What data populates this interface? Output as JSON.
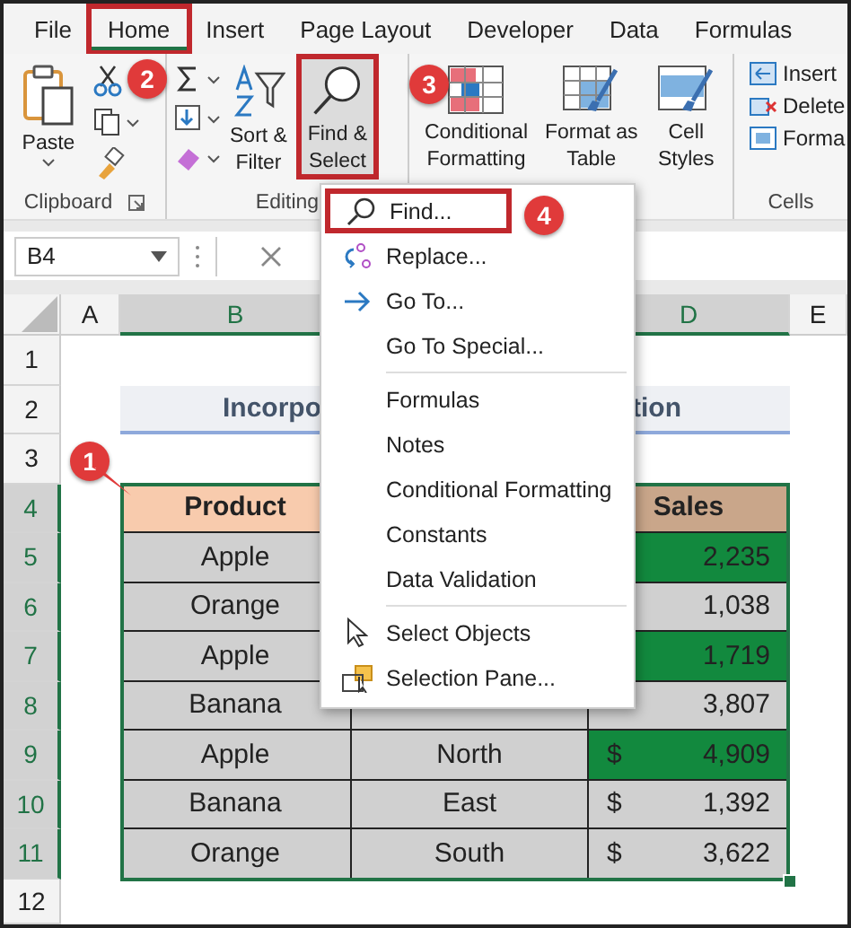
{
  "tabs": [
    {
      "label": "File",
      "selected": false,
      "boxed": false
    },
    {
      "label": "Home",
      "selected": true,
      "boxed": true
    },
    {
      "label": "Insert",
      "selected": false,
      "boxed": false
    },
    {
      "label": "Page Layout",
      "selected": false,
      "boxed": false
    },
    {
      "label": "Developer",
      "selected": false,
      "boxed": false
    },
    {
      "label": "Data",
      "selected": false,
      "boxed": false
    },
    {
      "label": "Formulas",
      "selected": false,
      "boxed": false
    }
  ],
  "clipboard": {
    "label": "Clipboard",
    "paste": "Paste"
  },
  "editing": {
    "label": "Editing",
    "sort_filter": [
      "Sort &",
      "Filter"
    ],
    "find_select": {
      "lines": [
        "Find &",
        "Select"
      ],
      "boxed": true
    }
  },
  "styles": {
    "conditional": [
      "Conditional",
      "Formatting"
    ],
    "format_table": [
      "Format as",
      "Table"
    ],
    "cell_styles": [
      "Cell",
      "Styles"
    ]
  },
  "cells": {
    "label": "Cells",
    "insert": "Insert",
    "delete": "Delete",
    "format": "Forma"
  },
  "name_box": "B4",
  "column_headers": [
    {
      "letter": "A",
      "selected": false
    },
    {
      "letter": "B",
      "selected": true
    },
    {
      "letter": "D",
      "selected": true
    },
    {
      "letter": "E",
      "selected": false
    }
  ],
  "row_headers": [
    {
      "num": "1",
      "selected": false
    },
    {
      "num": "2",
      "selected": false
    },
    {
      "num": "3",
      "selected": false
    },
    {
      "num": "4",
      "selected": true
    },
    {
      "num": "5",
      "selected": true
    },
    {
      "num": "6",
      "selected": true
    },
    {
      "num": "7",
      "selected": true
    },
    {
      "num": "8",
      "selected": true
    },
    {
      "num": "9",
      "selected": true
    },
    {
      "num": "10",
      "selected": true
    },
    {
      "num": "11",
      "selected": true
    },
    {
      "num": "12",
      "selected": false
    }
  ],
  "title": {
    "left": "Incorpo",
    "right": "tion"
  },
  "table": {
    "product_header": "Product",
    "sales_header": "Sales",
    "rows": [
      {
        "product": "Apple",
        "amount": "2,235",
        "highlight": true
      },
      {
        "product": "Orange",
        "amount": "1,038",
        "highlight": false
      },
      {
        "product": "Apple",
        "amount": "1,719",
        "highlight": true
      },
      {
        "product": "Banana",
        "amount": "3,807",
        "highlight": false
      },
      {
        "product": "Apple",
        "region": "North",
        "currency": "$",
        "amount": "4,909",
        "highlight": true
      },
      {
        "product": "Banana",
        "region": "East",
        "currency": "$",
        "amount": "1,392",
        "highlight": false
      },
      {
        "product": "Orange",
        "region": "South",
        "currency": "$",
        "amount": "3,622",
        "highlight": false
      }
    ]
  },
  "menu": {
    "groups": [
      [
        {
          "label": "Find...",
          "boxed": true
        },
        {
          "label": "Replace...",
          "boxed": false
        },
        {
          "label": "Go To...",
          "boxed": false
        },
        {
          "label": "Go To Special...",
          "boxed": false
        }
      ],
      [
        {
          "label": "Formulas",
          "boxed": false
        },
        {
          "label": "Notes",
          "boxed": false
        },
        {
          "label": "Conditional Formatting",
          "boxed": false
        },
        {
          "label": "Constants",
          "boxed": false
        },
        {
          "label": "Data Validation",
          "boxed": false
        }
      ],
      [
        {
          "label": "Select Objects",
          "boxed": false
        },
        {
          "label": "Selection Pane...",
          "boxed": false
        }
      ]
    ]
  },
  "steps": [
    {
      "label": "1",
      "pointer": true
    },
    {
      "label": "2",
      "pointer": false
    },
    {
      "label": "3",
      "pointer": false
    },
    {
      "label": "4",
      "pointer": false
    }
  ]
}
